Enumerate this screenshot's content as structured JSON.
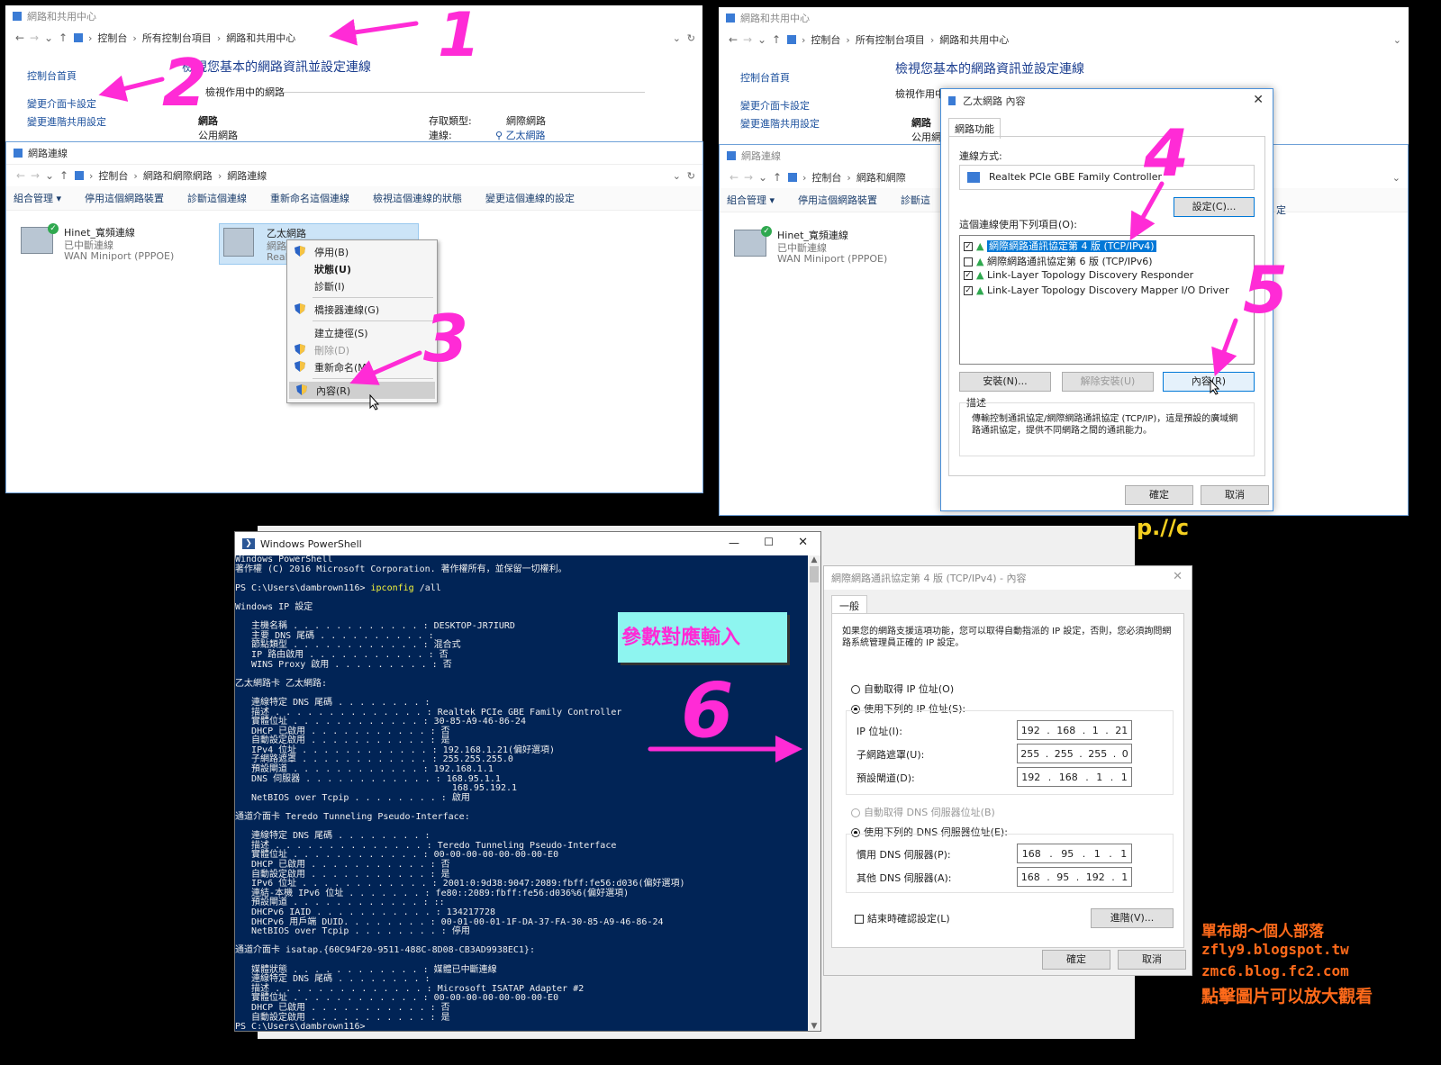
{
  "nc1": {
    "title": "網路和共用中心",
    "breadcrumb": [
      "控制台",
      "所有控制台項目",
      "網路和共用中心"
    ],
    "sidebar": [
      "控制台首頁",
      "變更介面卡設定",
      "變更進階共用設定"
    ],
    "heading": "檢視您基本的網路資訊並設定連線",
    "active_label": "檢視作用中的網路",
    "network_name": "網路",
    "network_type": "公用網路",
    "access_label": "存取類型:",
    "access_value": "網際網路",
    "conn_label": "連線:",
    "conn_value": "乙太網路"
  },
  "nconn": {
    "title": "網路連線",
    "breadcrumb": [
      "控制台",
      "網路和網際網路",
      "網路連線"
    ],
    "toolbar": [
      "組合管理 ▾",
      "停用這個網路裝置",
      "診斷這個連線",
      "重新命名這個連線",
      "檢視這個連線的狀態",
      "變更這個連線的設定"
    ],
    "adapter1": {
      "name": "Hinet_寬頻連線",
      "status": "已中斷連線",
      "device": "WAN Miniport (PPPOE)"
    },
    "adapter2": {
      "name": "乙太網路",
      "status": "網路",
      "device": "Real"
    }
  },
  "context_menu": {
    "items": [
      "停用(B)",
      "狀態(U)",
      "診斷(I)",
      "橋接器連線(G)",
      "建立捷徑(S)",
      "刪除(D)",
      "重新命名(M)",
      "內容(R)"
    ]
  },
  "nc2": {
    "title": "網路和共用中心",
    "breadcrumb": [
      "控制台",
      "所有控制台項目",
      "網路和共用中心"
    ],
    "sidebar": [
      "控制台首頁",
      "變更介面卡設定",
      "變更進階共用設定"
    ],
    "heading": "檢視您基本的網路資訊並設定連線",
    "active_label": "檢視作用中",
    "network_name": "網路",
    "network_type": "公用網"
  },
  "nconn2": {
    "title": "網路連線",
    "breadcrumb": [
      "控制台",
      "網路和網際"
    ],
    "toolbar": [
      "組合管理 ▾",
      "停用這個網路裝置",
      "診斷這"
    ],
    "adapter1": {
      "name": "Hinet_寬頻連線",
      "status": "已中斷連線",
      "device": "WAN Miniport (PPPOE)"
    }
  },
  "eth_props": {
    "title": "乙太網路 內容",
    "tab": "網路功能",
    "connect_using_label": "連線方式:",
    "adapter": "Realtek PCIe GBE Family Controller",
    "configure": "設定(C)...",
    "items_label": "這個連線使用下列項目(O):",
    "items": [
      {
        "label": "網際網路通訊協定第 4 版 (TCP/IPv4)",
        "checked": "✓"
      },
      {
        "label": "網際網路通訊協定第 6 版 (TCP/IPv6)",
        "checked": ""
      },
      {
        "label": "Link-Layer Topology Discovery Responder",
        "checked": "✓"
      },
      {
        "label": "Link-Layer Topology Discovery Mapper I/O Driver",
        "checked": "✓"
      }
    ],
    "install": "安裝(N)...",
    "uninstall": "解除安裝(U)",
    "properties": "內容(R)",
    "desc_label": "描述",
    "desc_text": "傳輸控制通訊協定/網際網路通訊協定 (TCP/IP)，這是預設的廣域網路通訊協定，提供不同網路之間的通訊能力。",
    "ok": "確定",
    "cancel": "取消",
    "side_peek": "定"
  },
  "powershell": {
    "title": "Windows PowerShell",
    "lines": [
      "Windows PowerShell",
      "著作權 (C) 2016 Microsoft Corporation. 著作權所有，並保留一切權利。",
      "",
      "PS C:\\Users\\dambrown116> ipconfig /all",
      "",
      "Windows IP 設定",
      "",
      "   主機名稱 . . . . . . . . . . . . : DESKTOP-JR7IURD",
      "   主要 DNS 尾碼 . . . . . . . . . . :",
      "   節點類型 . . . . . . . . . . . . : 混合式",
      "   IP 路由啟用 . . . . . . . . . . . : 否",
      "   WINS Proxy 啟用 . . . . . . . . . : 否",
      "",
      "乙太網路卡 乙太網路:",
      "",
      "   連線特定 DNS 尾碼 . . . . . . . . :",
      "   描述 . . . . . . . . . . . . . . : Realtek PCIe GBE Family Controller",
      "   實體位址 . . . . . . . . . . . . : 30-85-A9-46-86-24",
      "   DHCP 已啟用 . . . . . . . . . . . : 否",
      "   自動設定啟用 . . . . . . . . . . . : 是",
      "   IPv4 位址 . . . . . . . . . . . . : 192.168.1.21(偏好選項)",
      "   子網路遮罩 . . . . . . . . . . . . : 255.255.255.0",
      "   預設閘道 . . . . . . . . . . . . : 192.168.1.1",
      "   DNS 伺服器 . . . . . . . . . . . . : 168.95.1.1",
      "                                        168.95.192.1",
      "   NetBIOS over Tcpip . . . . . . . . : 啟用",
      "",
      "通道介面卡 Teredo Tunneling Pseudo-Interface:",
      "",
      "   連線特定 DNS 尾碼 . . . . . . . . :",
      "   描述 . . . . . . . . . . . . . . : Teredo Tunneling Pseudo-Interface",
      "   實體位址 . . . . . . . . . . . . : 00-00-00-00-00-00-00-E0",
      "   DHCP 已啟用 . . . . . . . . . . . : 否",
      "   自動設定啟用 . . . . . . . . . . . : 是",
      "   IPv6 位址 . . . . . . . . . . . . : 2001:0:9d38:9047:2089:fbff:fe56:d036(偏好選項)",
      "   連結-本機 IPv6 位址 . . . . . . . : fe80::2089:fbff:fe56:d036%6(偏好選項)",
      "   預設閘道 . . . . . . . . . . . . : ::",
      "   DHCPv6 IAID . . . . . . . . . . . : 134217728",
      "   DHCPv6 用戶端 DUID. . . . . . . . : 00-01-00-01-1F-DA-37-FA-30-85-A9-46-86-24",
      "   NetBIOS over Tcpip . . . . . . . . : 停用",
      "",
      "通道介面卡 isatap.{60C94F20-9511-488C-8D08-CB3AD9938EC1}:",
      "",
      "   媒體狀態 . . . . . . . . . . . . : 媒體已中斷連線",
      "   連線特定 DNS 尾碼 . . . . . . . . :",
      "   描述 . . . . . . . . . . . . . . : Microsoft ISATAP Adapter #2",
      "   實體位址 . . . . . . . . . . . . : 00-00-00-00-00-00-00-E0",
      "   DHCP 已啟用 . . . . . . . . . . . : 否",
      "   自動設定啟用 . . . . . . . . . . . : 是",
      "PS C:\\Users\\dambrown116> _"
    ]
  },
  "ipv4": {
    "title": "網際網路通訊協定第 4 版 (TCP/IPv4) - 內容",
    "tab": "一般",
    "intro": "如果您的網路支援這項功能，您可以取得自動指派的 IP 設定，否則，您必須詢問網路系統管理員正確的 IP 設定。",
    "auto_ip": "自動取得 IP 位址(O)",
    "manual_ip": "使用下列的 IP 位址(S):",
    "ip_label": "IP 位址(I):",
    "ip": [
      "192",
      "168",
      "1",
      "21"
    ],
    "mask_label": "子網路遮罩(U):",
    "mask": [
      "255",
      "255",
      "255",
      "0"
    ],
    "gw_label": "預設閘道(D):",
    "gw": [
      "192",
      "168",
      "1",
      "1"
    ],
    "auto_dns": "自動取得 DNS 伺服器位址(B)",
    "manual_dns": "使用下列的 DNS 伺服器位址(E):",
    "dns1_label": "慣用 DNS 伺服器(P):",
    "dns1": [
      "168",
      "95",
      "1",
      "1"
    ],
    "dns2_label": "其他 DNS 伺服器(A):",
    "dns2": [
      "168",
      "95",
      "192",
      "1"
    ],
    "validate": "結束時確認設定(L)",
    "advanced": "進階(V)...",
    "ok": "確定",
    "cancel": "取消"
  },
  "annotations": {
    "steps": [
      "1",
      "2",
      "3",
      "4",
      "5",
      "6"
    ],
    "callout": "參數對應輸入",
    "peek_text": "p.//c"
  },
  "watermark": [
    "單布朗～個人部落",
    "zfly9.blogspot.tw",
    "zmc6.blog.fc2.com",
    "點擊圖片可以放大觀看"
  ],
  "colors": {
    "annotation": "#ff2bd6",
    "ps_bg": "#012456",
    "watermark": "#ff6a1a",
    "callout_bg": "#8ef5f0"
  }
}
